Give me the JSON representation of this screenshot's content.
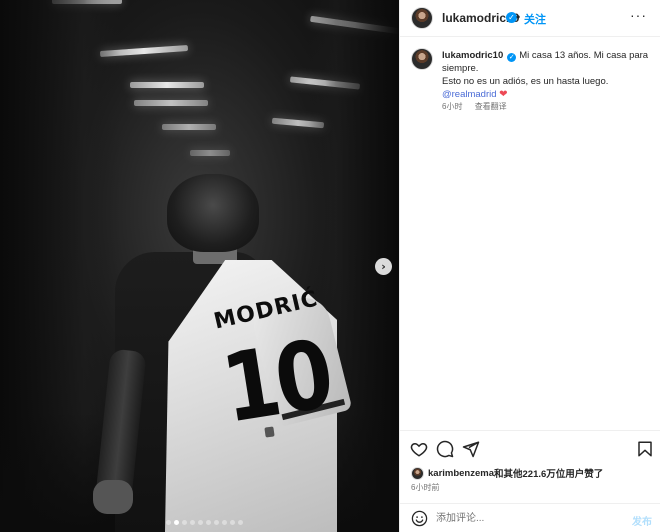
{
  "media": {
    "jersey_name": "MODRIĆ",
    "jersey_number": "10",
    "carousel": {
      "next_icon": "›",
      "slide_count": 10,
      "active_index": 1
    }
  },
  "post": {
    "username": "lukamodric10",
    "verified_mark": "✓",
    "separator": "•",
    "follow_label": "关注",
    "more_label": "···",
    "caption_line1": "Mi casa 13 años. Mi casa para siempre.",
    "caption_line2": "Esto no es un adiós, es un hasta luego.",
    "caption_mention": "@realmadrid",
    "caption_emoji": "❤",
    "caption_time": "6小时",
    "translate_label": "查看翻译"
  },
  "actions": {
    "icons": [
      "heart-icon",
      "comment-icon",
      "share-icon",
      "bookmark-icon"
    ]
  },
  "likes": {
    "liker_username": "karimbenzema",
    "text": "和其他221.6万位用户赞了"
  },
  "timestamp": "6小时前",
  "comment": {
    "placeholder": "添加评论...",
    "post_label": "发布"
  },
  "colors": {
    "accent": "#0095f6",
    "heart": "#ed4956",
    "mention": "#4a6bd6"
  }
}
